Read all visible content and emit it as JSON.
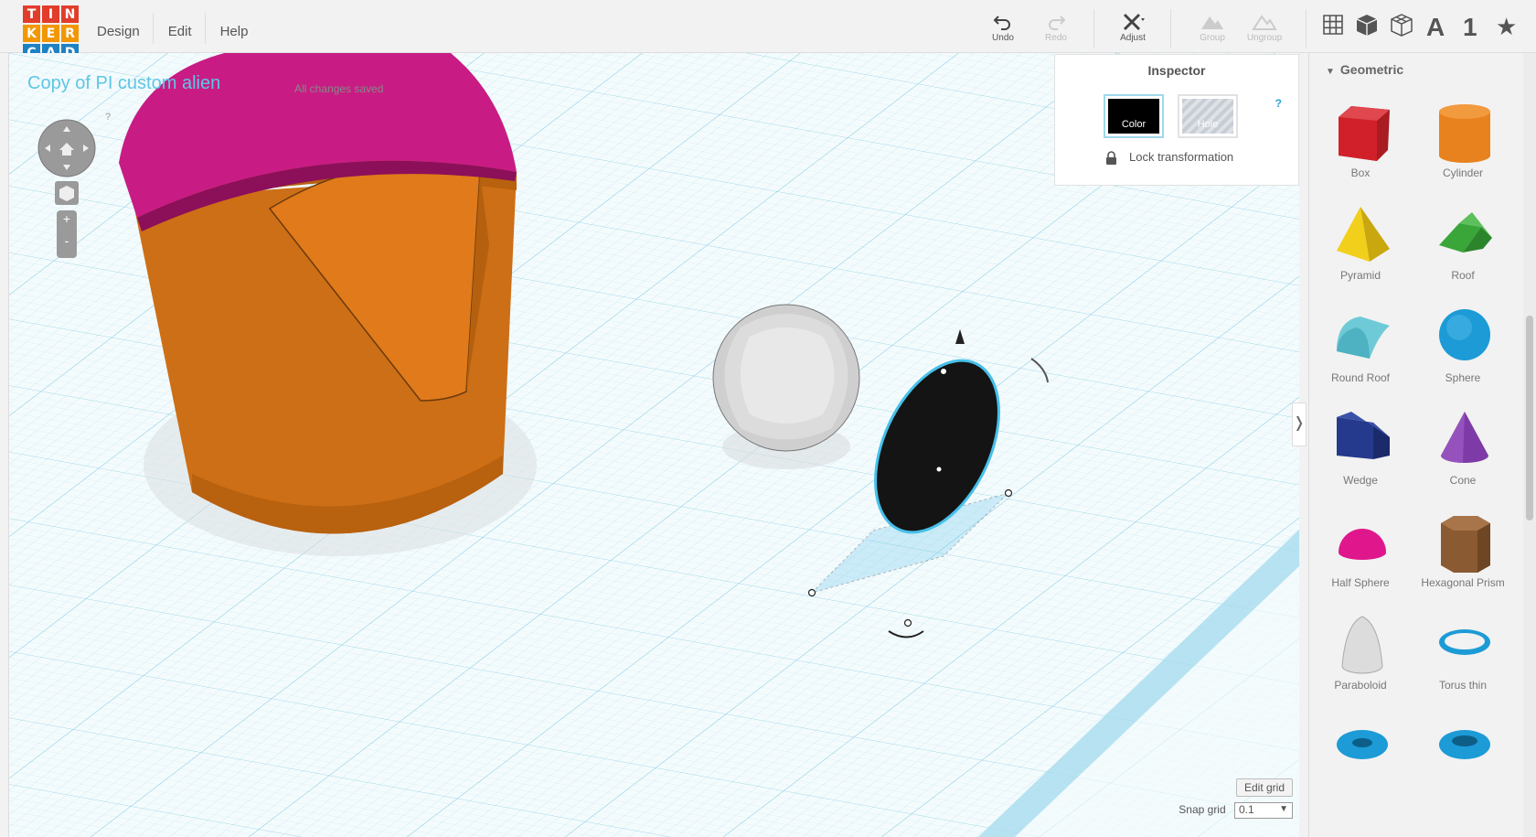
{
  "app": {
    "logo_letters": [
      "T",
      "I",
      "N",
      "K",
      "E",
      "R",
      "C",
      "A",
      "D"
    ],
    "logo_colors": [
      "#e23c2a",
      "#e23c2a",
      "#e23c2a",
      "#f29700",
      "#f29700",
      "#f29700",
      "#1d82c4",
      "#1d82c4",
      "#1d82c4"
    ]
  },
  "menu": [
    {
      "label": "Design"
    },
    {
      "label": "Edit"
    },
    {
      "label": "Help"
    }
  ],
  "toolbar": {
    "undo": "Undo",
    "redo": "Redo",
    "adjust": "Adjust",
    "group": "Group",
    "ungroup": "Ungroup"
  },
  "view_icons": [
    "grid-icon",
    "cube-icon",
    "wireframe-cube-icon",
    "letter-a-icon",
    "number-one-icon",
    "star-icon"
  ],
  "view_text": {
    "letter": "A",
    "number": "1",
    "star": "★"
  },
  "project": {
    "title": "Copy of PI custom alien",
    "status": "All changes saved"
  },
  "inspector": {
    "title": "Inspector",
    "color_label": "Color",
    "hole_label": "Hole",
    "lock_label": "Lock transformation",
    "help": "?"
  },
  "nav": {
    "zoom_in": "+",
    "zoom_out": "-",
    "help": "?"
  },
  "sidebar": {
    "category": "Geometric",
    "shapes": [
      {
        "label": "Box",
        "color": "#d2202a"
      },
      {
        "label": "Cylinder",
        "color": "#e8821e"
      },
      {
        "label": "Pyramid",
        "color": "#f2cf1a"
      },
      {
        "label": "Roof",
        "color": "#3aa63a"
      },
      {
        "label": "Round Roof",
        "color": "#6fcad8"
      },
      {
        "label": "Sphere",
        "color": "#1c9bd6"
      },
      {
        "label": "Wedge",
        "color": "#253a8c"
      },
      {
        "label": "Cone",
        "color": "#7e3aa6"
      },
      {
        "label": "Half Sphere",
        "color": "#e0178c"
      },
      {
        "label": "Hexagonal Prism",
        "color": "#8a5a32"
      },
      {
        "label": "Paraboloid",
        "color": "#dcdcdc"
      },
      {
        "label": "Torus thin",
        "color": "#1c9bd6"
      },
      {
        "label": "",
        "color": "#1c9bd6"
      },
      {
        "label": "",
        "color": "#1c9bd6"
      }
    ]
  },
  "grid": {
    "edit_label": "Edit grid",
    "snap_label": "Snap grid",
    "snap_value": "0.1"
  }
}
